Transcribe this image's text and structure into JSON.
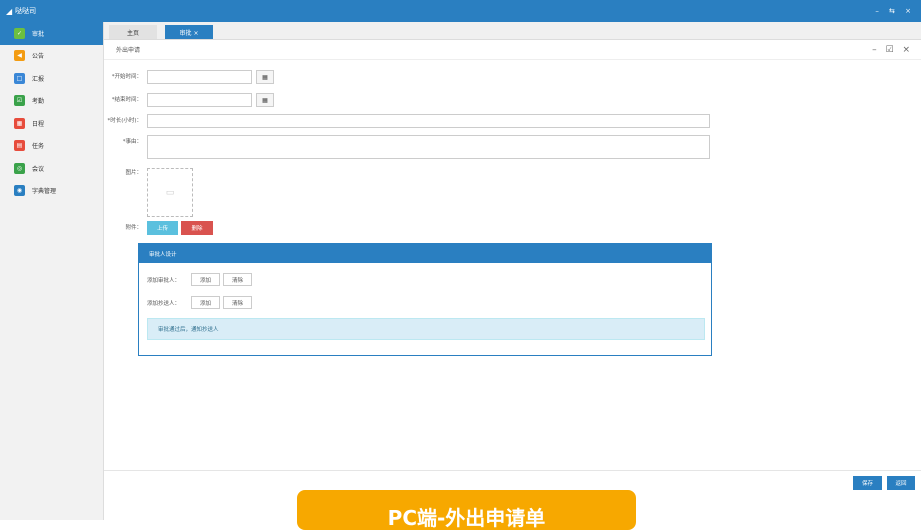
{
  "window": {
    "title": "哒哒司",
    "controls": "– ⇆ ×"
  },
  "sidebar": {
    "items": [
      {
        "label": "审批",
        "icon": "approval-icon",
        "color": "#6cbf3f",
        "active": true
      },
      {
        "label": "公告",
        "icon": "announcement-icon",
        "color": "#f39c12"
      },
      {
        "label": "汇报",
        "icon": "report-icon",
        "color": "#3a87d6"
      },
      {
        "label": "考勤",
        "icon": "attendance-icon",
        "color": "#3aa24a"
      },
      {
        "label": "日程",
        "icon": "calendar-icon",
        "color": "#e74c3c"
      },
      {
        "label": "任务",
        "icon": "task-icon",
        "color": "#e74c3c"
      },
      {
        "label": "会议",
        "icon": "meeting-icon",
        "color": "#3aa24a"
      },
      {
        "label": "字典管理",
        "icon": "dictionary-icon",
        "color": "#2a7fc1"
      }
    ]
  },
  "tabs": {
    "home": "主页",
    "active": "审批 ×"
  },
  "panel": {
    "title": "外出申请",
    "controls": "– ☑ ×"
  },
  "form": {
    "start_time_label": "*开始时间：",
    "end_time_label": "*结束时间：",
    "duration_label": "*时长(小时)：",
    "reason_label": "*事由：",
    "image_label": "图片：",
    "attachment_label": "附件：",
    "upload_button": "上传",
    "delete_button": "删除"
  },
  "approval": {
    "title": "审批人设计",
    "approver_label": "添加审批人：",
    "cc_label": "添加抄送人：",
    "add_button": "添加",
    "clear_button": "清除",
    "info": "审批通过后，通知抄送人"
  },
  "footer": {
    "save": "保存",
    "back": "返回"
  },
  "caption": "PC端-外出申请单",
  "colors": {
    "primary": "#2a7fc1",
    "danger": "#d9534f",
    "info": "#5bc0de",
    "caption": "#f7a800"
  }
}
